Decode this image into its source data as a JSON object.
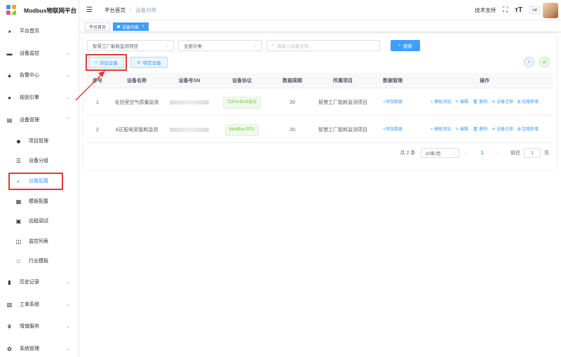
{
  "app": {
    "title": "Modbus物联网平台"
  },
  "colors": {
    "accent": "#409eff",
    "annotation_red": "#e53935"
  },
  "sidebar": {
    "items": [
      {
        "label": "平台首页",
        "icon": "speedometer-icon"
      },
      {
        "label": "设备监控",
        "icon": "monitor-icon"
      },
      {
        "label": "告警中心",
        "icon": "alarm-icon"
      },
      {
        "label": "规则引擎",
        "icon": "rule-icon"
      },
      {
        "label": "设备管理",
        "icon": "device-icon"
      },
      {
        "label": "项目管理",
        "icon": "layers-icon"
      },
      {
        "label": "设备分组",
        "icon": "group-icon"
      },
      {
        "label": "设备配置",
        "icon": "toggle-icon"
      },
      {
        "label": "模板配置",
        "icon": "template-icon"
      },
      {
        "label": "远程调试",
        "icon": "debug-icon"
      },
      {
        "label": "监控列表",
        "icon": "camera-icon"
      },
      {
        "label": "行业模板",
        "icon": "square-icon"
      },
      {
        "label": "历史记录",
        "icon": "bar-chart-icon"
      },
      {
        "label": "工单系统",
        "icon": "ticket-icon"
      },
      {
        "label": "增值服务",
        "icon": "crown-icon"
      },
      {
        "label": "系统管理",
        "icon": "gear-icon"
      }
    ]
  },
  "header": {
    "breadcrumb_home": "平台首页",
    "breadcrumb_sep": "/",
    "breadcrumb_current": "设备列表",
    "support": "技术支持",
    "user": "iot"
  },
  "tags": {
    "home": "平台首页",
    "current": "设备列表",
    "close": "×"
  },
  "filters": {
    "project": "智慧工厂能耗监测项目",
    "category": "全部分类",
    "search_placeholder": "请输入设备名称...",
    "search_button": "搜索"
  },
  "actions": {
    "add_device": "添加设备",
    "bind_device": "绑定设备"
  },
  "table": {
    "headers": [
      "序号",
      "设备名称",
      "设备号SN",
      "设备协议",
      "数据周期",
      "所属项目",
      "数据管理",
      "操作"
    ],
    "rows": [
      {
        "index": "1",
        "name": "化验室空气质量监测",
        "protocol": "TDFH-BUS协议",
        "period": "20",
        "project": "智慧工厂能耗监测项目",
        "data_link": "+添加数据"
      },
      {
        "index": "2",
        "name": "A区配电室能耗监测",
        "protocol": "ModBus RTU",
        "period": "20",
        "project": "智慧工厂能耗监测项目",
        "data_link": "+添加数据"
      }
    ],
    "ops": [
      "+ 模板添加",
      "编辑",
      "删除",
      "设备迁移",
      "克隆新增"
    ]
  },
  "pagination": {
    "total": "共 2 条",
    "page_size": "10条/页",
    "current_page": "1",
    "goto_label": "前往",
    "goto_value": "1",
    "page_unit": "页"
  }
}
